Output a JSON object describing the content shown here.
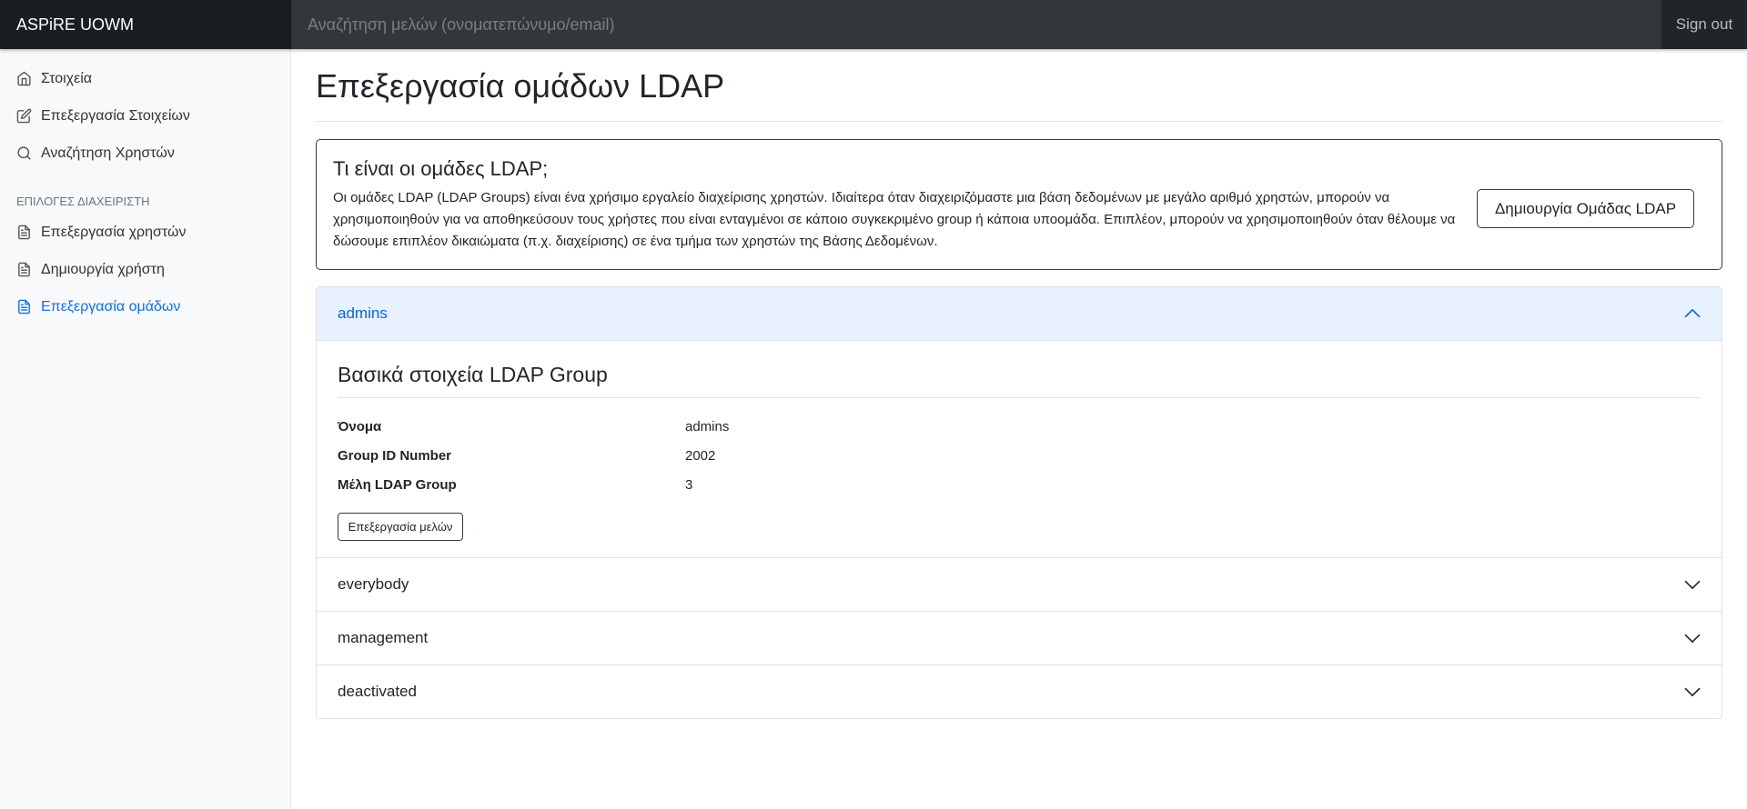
{
  "navbar": {
    "brand": "ASPiRE UOWM",
    "search_placeholder": "Αναζήτηση μελών (ονοματεπώνυμο/email)",
    "signout_label": "Sign out"
  },
  "sidebar": {
    "items": [
      {
        "label": "Στοιχεία",
        "icon": "home-icon"
      },
      {
        "label": "Επεξεργασία Στοιχείων",
        "icon": "edit-icon"
      },
      {
        "label": "Αναζήτηση Χρηστών",
        "icon": "search-icon"
      }
    ],
    "admin_heading": "ΕΠΙΛΟΓΕΣ ΔΙΑΧΕΙΡΙΣΤΗ",
    "admin_items": [
      {
        "label": "Επεξεργασία χρηστών",
        "icon": "file-text-icon"
      },
      {
        "label": "Δημιουργία χρήστη",
        "icon": "file-text-icon"
      },
      {
        "label": "Επεξεργασία ομάδων",
        "icon": "file-text-icon",
        "active": true
      }
    ]
  },
  "main": {
    "title": "Επεξεργασία ομάδων LDAP",
    "info": {
      "title": "Τι είναι οι ομάδες LDAP;",
      "text": "Οι ομάδες LDAP (LDAP Groups) είναι ένα χρήσιμο εργαλείο διαχείρισης χρηστών. Ιδιαίτερα όταν διαχειριζόμαστε μια βάση δεδομένων με μεγάλο αριθμό χρηστών, μπορούν να χρησιμοποιηθούν για να αποθηκεύσουν τους χρήστες που είναι ενταγμένοι σε κάποιο συγκεκριμένο group ή κάποια υποομάδα. Επιπλέον, μπορούν να χρησιμοποιηθούν όταν θέλουμε να δώσουμε επιπλέον δικαιώματα (π.χ. διαχείρισης) σε ένα τμήμα των χρηστών της Βάσης Δεδομένων.",
      "create_button": "Δημιουργία Ομάδας LDAP"
    },
    "groups": [
      {
        "name": "admins",
        "expanded": true
      },
      {
        "name": "everybody",
        "expanded": false
      },
      {
        "name": "management",
        "expanded": false
      },
      {
        "name": "deactivated",
        "expanded": false
      }
    ],
    "details": {
      "title": "Βασικά στοιχεία LDAP Group",
      "rows": [
        {
          "label": "Όνομα",
          "value": "admins"
        },
        {
          "label": "Group ID Number",
          "value": "2002"
        },
        {
          "label": "Μέλη LDAP Group",
          "value": "3"
        }
      ],
      "members_button": "Επεξεργασία μελών"
    }
  },
  "colors": {
    "navbar": "#212529",
    "accent": "#0d6efd",
    "open_header_bg": "#e7f1ff"
  }
}
